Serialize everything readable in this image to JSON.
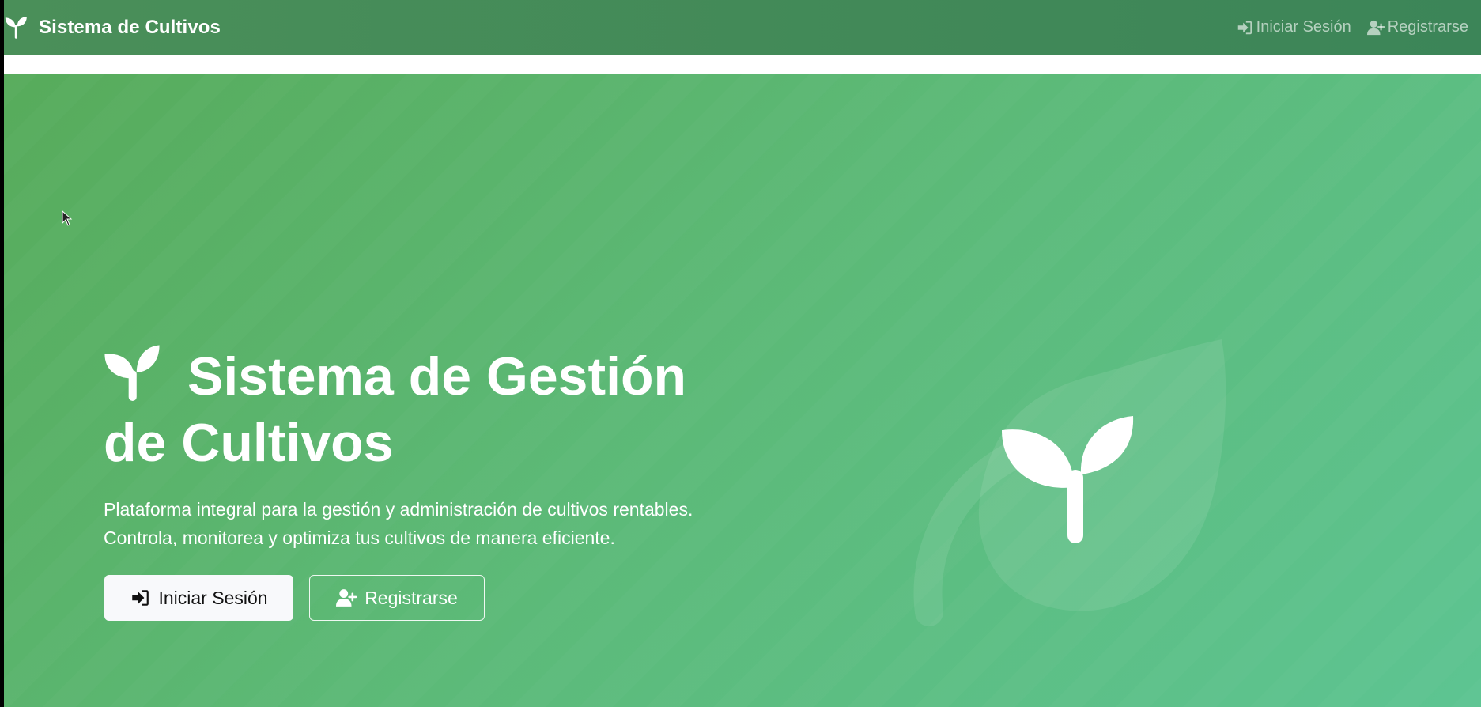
{
  "navbar": {
    "brand": "Sistema de Cultivos",
    "brand_icon": "seedling-icon",
    "links": [
      {
        "label": "Iniciar Sesión",
        "icon": "sign-in-icon"
      },
      {
        "label": "Registrarse",
        "icon": "user-plus-icon"
      }
    ]
  },
  "hero": {
    "title": "Sistema de Gestión de Cultivos",
    "description_line1": "Plataforma integral para la gestión y administración de cultivos rentables.",
    "description_line2": "Controla, monitorea y optimiza tus cultivos de manera eficiente.",
    "buttons": {
      "login": "Iniciar Sesión",
      "register": "Registrarse"
    },
    "illustration_icon": "seedling-icon"
  },
  "colors": {
    "navbar": "#3c8558",
    "hero_start": "#57ab5b",
    "hero_end": "#5dc492",
    "text": "#ffffff"
  }
}
